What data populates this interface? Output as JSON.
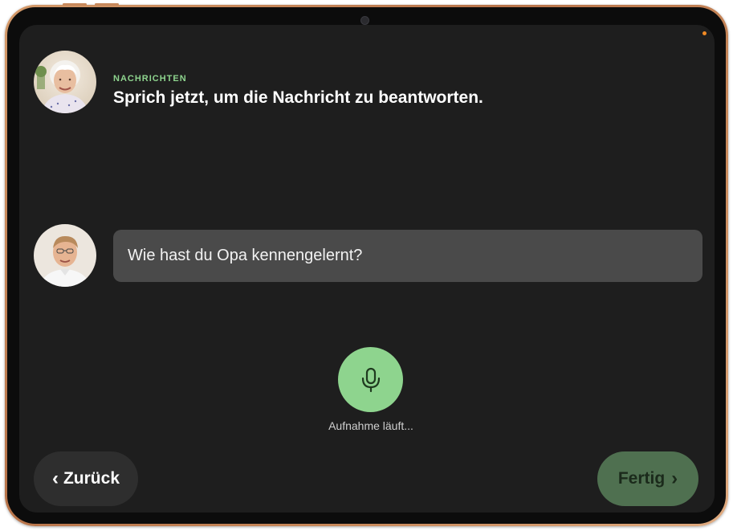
{
  "header": {
    "section_label": "NACHRICHTEN",
    "title": "Sprich jetzt, um die Nachricht zu beantworten."
  },
  "message": {
    "text": "Wie hast du Opa kennengelernt?"
  },
  "recording": {
    "status": "Aufnahme läuft..."
  },
  "navigation": {
    "back_chevron": "‹",
    "back_label": "Zurück",
    "done_label": "Fertig",
    "done_chevron": "›"
  },
  "icons": {
    "recipient_avatar": "elderly-woman-avatar",
    "sender_avatar": "young-man-avatar",
    "mic": "microphone-icon"
  },
  "colors": {
    "accent": "#8ed48e",
    "screen_bg": "#1e1e1e",
    "bubble_bg": "#4a4a4a",
    "done_button_bg": "#4f7050",
    "back_button_bg": "#2e2e2e",
    "status_dot": "#f08a24"
  }
}
